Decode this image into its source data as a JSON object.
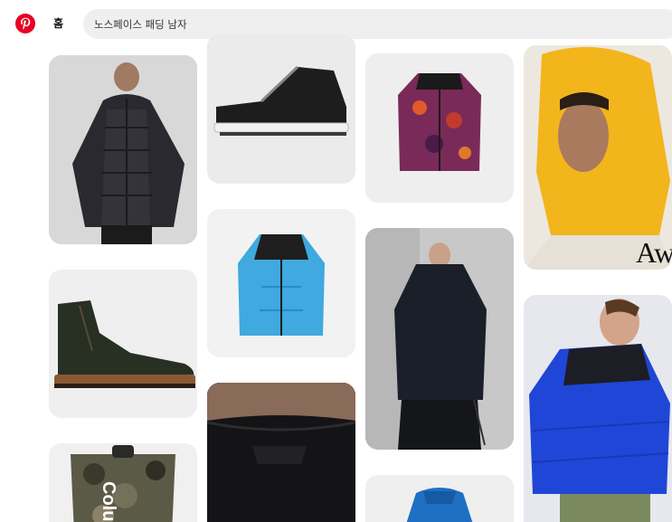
{
  "header": {
    "logo_icon": "pinterest-logo-icon",
    "brand_color": "#e60023",
    "home_label": "홈",
    "search_value": "노스페이스 패딩 남자"
  },
  "pins": [
    {
      "subject": "man-black-puffer-jacket",
      "icon": "jacket-icon"
    },
    {
      "subject": "black-sneaker",
      "icon": "shoe-icon"
    },
    {
      "subject": "purple-orange-camo-nuptse",
      "icon": "jacket-icon"
    },
    {
      "subject": "yellow-hood-model",
      "icon": "hood-icon",
      "overlay_text": "Aw"
    },
    {
      "subject": "dark-green-leather-boot",
      "icon": "boot-icon"
    },
    {
      "subject": "blue-black-nuptse",
      "icon": "jacket-icon"
    },
    {
      "subject": "navy-parka-back-view",
      "icon": "parka-icon"
    },
    {
      "subject": "man-blue-puffer-jacket",
      "icon": "jacket-icon"
    },
    {
      "subject": "camo-backpack",
      "icon": "backpack-icon",
      "overlay_text": "Colu"
    },
    {
      "subject": "black-collar-closeup",
      "icon": "fabric-icon"
    },
    {
      "subject": "blue-jacket-partial",
      "icon": "jacket-icon"
    }
  ]
}
